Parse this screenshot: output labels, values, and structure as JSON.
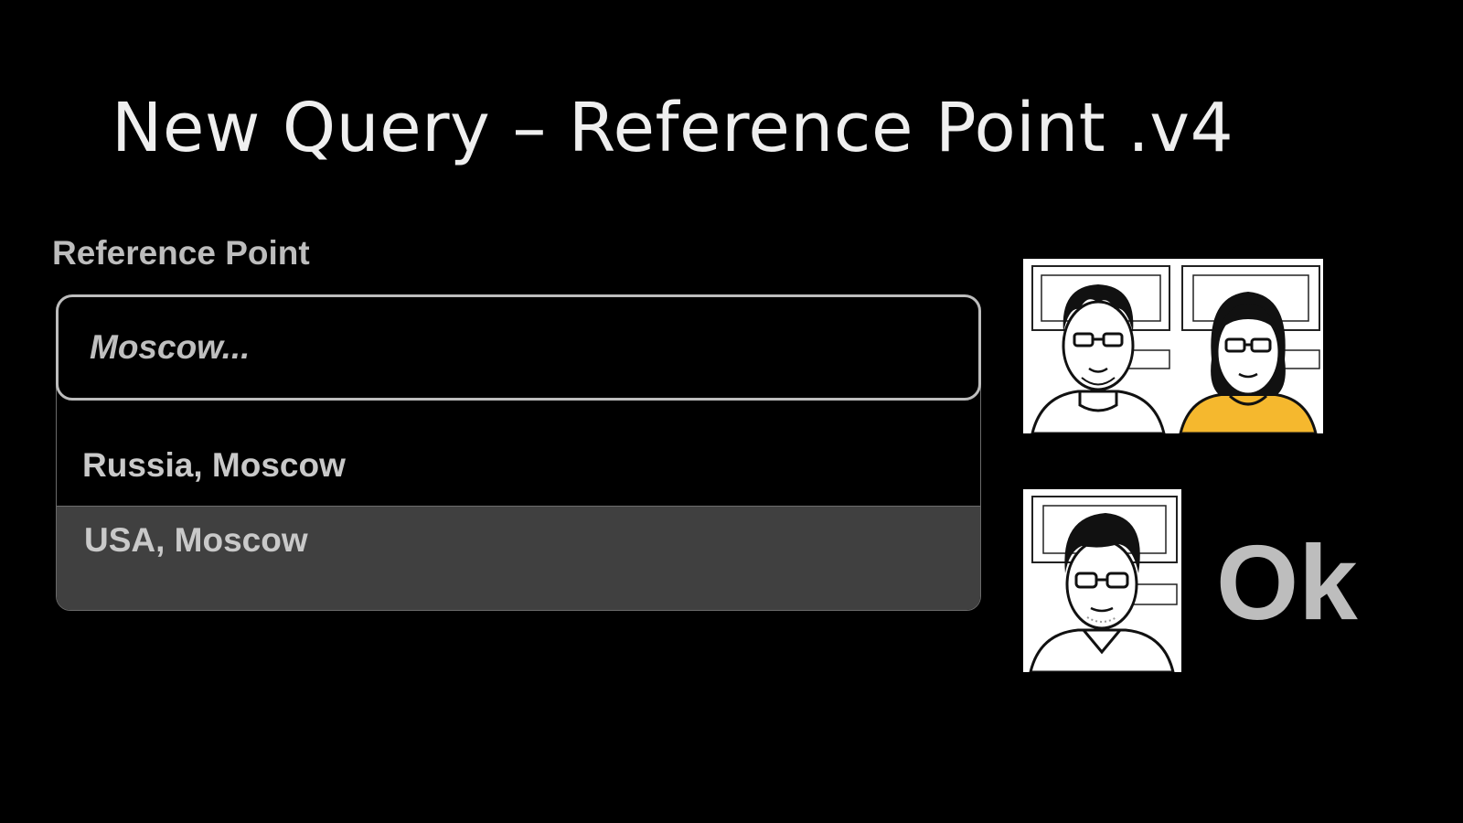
{
  "window": {
    "title": "New Query – Reference Point .v4"
  },
  "reference_point": {
    "label": "Reference Point",
    "input": {
      "value": "",
      "placeholder": "Moscow..."
    },
    "options": [
      {
        "label": "Russia, Moscow",
        "highlighted": false
      },
      {
        "label": "USA, Moscow",
        "highlighted": true
      }
    ]
  },
  "users": [
    {
      "avatar": "user-avatar-icon",
      "shirt_color": "#ffffff"
    },
    {
      "avatar": "user-avatar-icon",
      "shirt_color": "#f5b82e"
    },
    {
      "avatar": "user-avatar-icon",
      "shirt_color": "#ffffff"
    }
  ],
  "actions": {
    "ok_label": "Ok"
  },
  "colors": {
    "background": "#000000",
    "highlight": "#404040",
    "accent_yellow": "#f5b82e"
  }
}
